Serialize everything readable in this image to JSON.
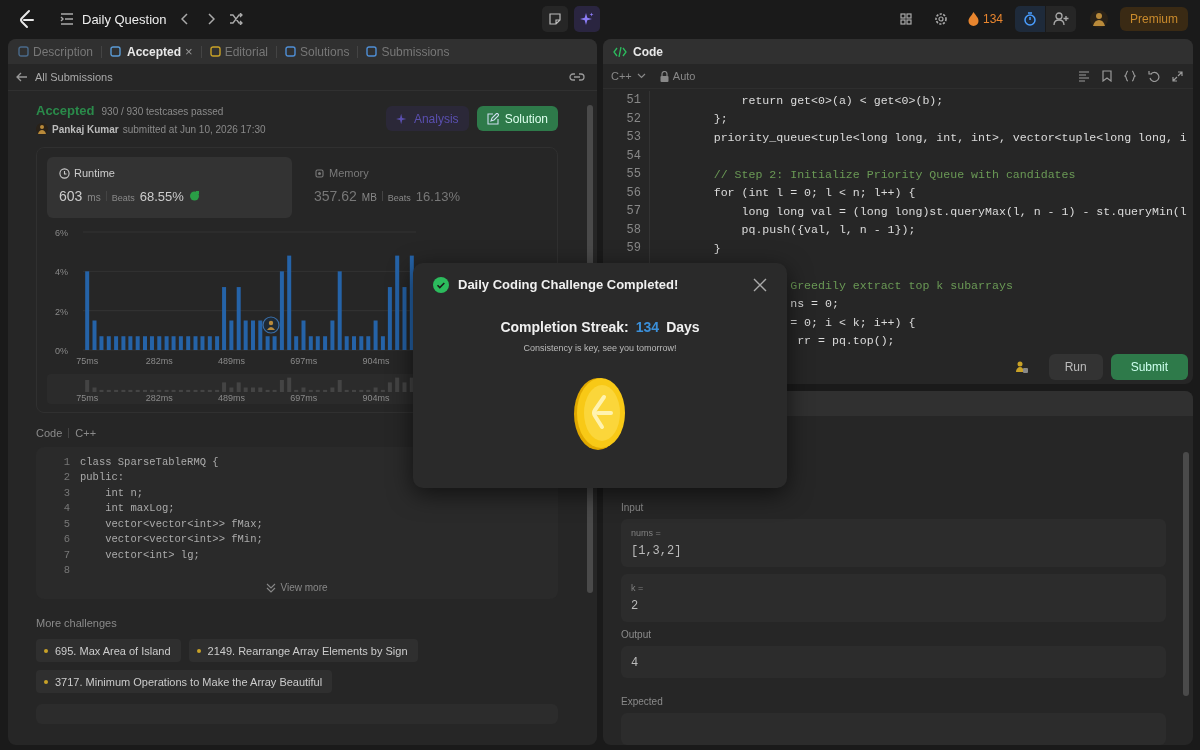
{
  "topbar": {
    "title": "Daily Question",
    "streak": "134",
    "premium": "Premium"
  },
  "left_tabs": [
    {
      "label": "Description",
      "selected": false
    },
    {
      "label": "Accepted",
      "selected": true,
      "close": "×"
    },
    {
      "label": "Editorial",
      "selected": false
    },
    {
      "label": "Solutions",
      "selected": false
    },
    {
      "label": "Submissions",
      "selected": false
    }
  ],
  "back_link": "All Submissions",
  "result": {
    "status": "Accepted",
    "testcases": "930 / 930 testcases passed",
    "user": "Pankaj Kumar",
    "submitted": "submitted at Jun 10, 2026 17:30"
  },
  "actions": [
    {
      "label": "Analysis",
      "kind": "ai"
    },
    {
      "label": "Solution",
      "kind": "primary"
    }
  ],
  "stats": [
    {
      "title": "Runtime",
      "value": "603",
      "unit": "ms",
      "beats_label": "Beats",
      "beats": "68.55%",
      "selected": true
    },
    {
      "title": "Memory",
      "value": "357.62",
      "unit": "MB",
      "beats_label": "Beats",
      "beats": "16.13%",
      "selected": false
    }
  ],
  "chart_data": {
    "type": "bar",
    "x": [
      75,
      96,
      116,
      137,
      158,
      179,
      199,
      220,
      241,
      261,
      282,
      303,
      323,
      344,
      365,
      386,
      406,
      427,
      448,
      468,
      489,
      510,
      530,
      551,
      572,
      593,
      613,
      634,
      655,
      675,
      696,
      717,
      737,
      758,
      779,
      800,
      820,
      841,
      862,
      882,
      903,
      924,
      944,
      965,
      986,
      1007
    ],
    "values": [
      4.0,
      1.5,
      0.7,
      0.7,
      0.7,
      0.7,
      0.7,
      0.7,
      0.7,
      0.7,
      0.7,
      0.7,
      0.7,
      0.7,
      0.7,
      0.7,
      0.7,
      0.7,
      0.7,
      3.2,
      1.5,
      3.2,
      1.5,
      1.5,
      1.5,
      0.7,
      0.7,
      4.0,
      4.8,
      0.7,
      1.5,
      0.7,
      0.7,
      0.7,
      1.5,
      4.0,
      0.7,
      0.7,
      0.7,
      0.7,
      1.5,
      0.7,
      3.2,
      4.8,
      3.2,
      4.8
    ],
    "xlim": [
      63,
      1019
    ],
    "ylim": [
      0,
      6
    ],
    "yticks": [
      {
        "value": 0,
        "label": "0%"
      },
      {
        "value": 2,
        "label": "2%"
      },
      {
        "value": 4,
        "label": "4%"
      },
      {
        "value": 6,
        "label": "6%"
      }
    ],
    "xticks": [
      {
        "value": 75,
        "label": "75ms"
      },
      {
        "value": 282,
        "label": "282ms"
      },
      {
        "value": 489,
        "label": "489ms"
      },
      {
        "value": 697,
        "label": "697ms"
      },
      {
        "value": 904,
        "label": "904ms"
      }
    ]
  },
  "navigator_labels": [
    "75ms",
    "282ms",
    "489ms",
    "697ms",
    "904ms"
  ],
  "code_header": {
    "label": "Code",
    "language": "C++"
  },
  "code_preview": [
    {
      "n": "1",
      "kind": "code",
      "text": "class SparseTableRMQ {"
    },
    {
      "n": "2",
      "kind": "code",
      "text": "public:"
    },
    {
      "n": "3",
      "kind": "code",
      "text": "    int n;"
    },
    {
      "n": "4",
      "kind": "code",
      "text": "    int maxLog;"
    },
    {
      "n": "5",
      "kind": "code",
      "text": "    vector<vector<int>> fMax;"
    },
    {
      "n": "6",
      "kind": "code",
      "text": "    vector<vector<int>> fMin;"
    },
    {
      "n": "7",
      "kind": "code",
      "text": "    vector<int> lg;"
    },
    {
      "n": "8",
      "kind": "blank"
    }
  ],
  "view_more": "View more",
  "challenges_title": "More challenges",
  "challenges": [
    "695. Max Area of Island",
    "2149. Rearrange Array Elements by Sign",
    "3717. Minimum Operations to Make the Array Beautiful"
  ],
  "editor": {
    "tab": "Code",
    "language": "C++",
    "mode": "Auto",
    "lines": [
      {
        "n": "51",
        "kind": "code",
        "text": "            return get<0>(a) < get<0>(b);"
      },
      {
        "n": "52",
        "kind": "code",
        "text": "        };"
      },
      {
        "n": "53",
        "kind": "code",
        "text": "        priority_queue<tuple<long long, int, int>, vector<tuple<long long, i"
      },
      {
        "n": "54",
        "kind": "blank"
      },
      {
        "n": "55",
        "kind": "comment",
        "text": "        // Step 2: Initialize Priority Queue with candidates"
      },
      {
        "n": "56",
        "kind": "code",
        "text": "        for (int l = 0; l < n; l++) {"
      },
      {
        "n": "57",
        "kind": "code",
        "text": "            long long val = (long long)st.queryMax(l, n - 1) - st.queryMin(l"
      },
      {
        "n": "58",
        "kind": "code",
        "text": "            pq.push({val, l, n - 1});"
      },
      {
        "n": "59",
        "kind": "code",
        "text": "        }"
      },
      {
        "kind": "blank"
      },
      {
        "kind": "comment",
        "text": "                   Greedily extract top k subarrays"
      },
      {
        "kind": "code",
        "text": "                   ns = 0;"
      },
      {
        "kind": "code",
        "text": "                   = 0; i < k; i++) {"
      },
      {
        "kind": "code",
        "text": "                    rr = pq.top();"
      }
    ],
    "buttons": [
      {
        "label": "Run",
        "kind": "secondary"
      },
      {
        "label": "Submit",
        "kind": "primary"
      }
    ]
  },
  "testcase": {
    "input_label": "Input",
    "inputs": [
      {
        "name": "nums =",
        "value": "[1,3,2]"
      },
      {
        "name": "k =",
        "value": "2"
      }
    ],
    "output_label": "Output",
    "output": "4",
    "expected_label": "Expected"
  },
  "dialog": {
    "title": "Daily Coding Challenge Completed!",
    "streak_label": "Completion Streak:",
    "streak": "134",
    "streak_unit": "Days",
    "message": "Consistency is key, see you tomorrow!"
  }
}
